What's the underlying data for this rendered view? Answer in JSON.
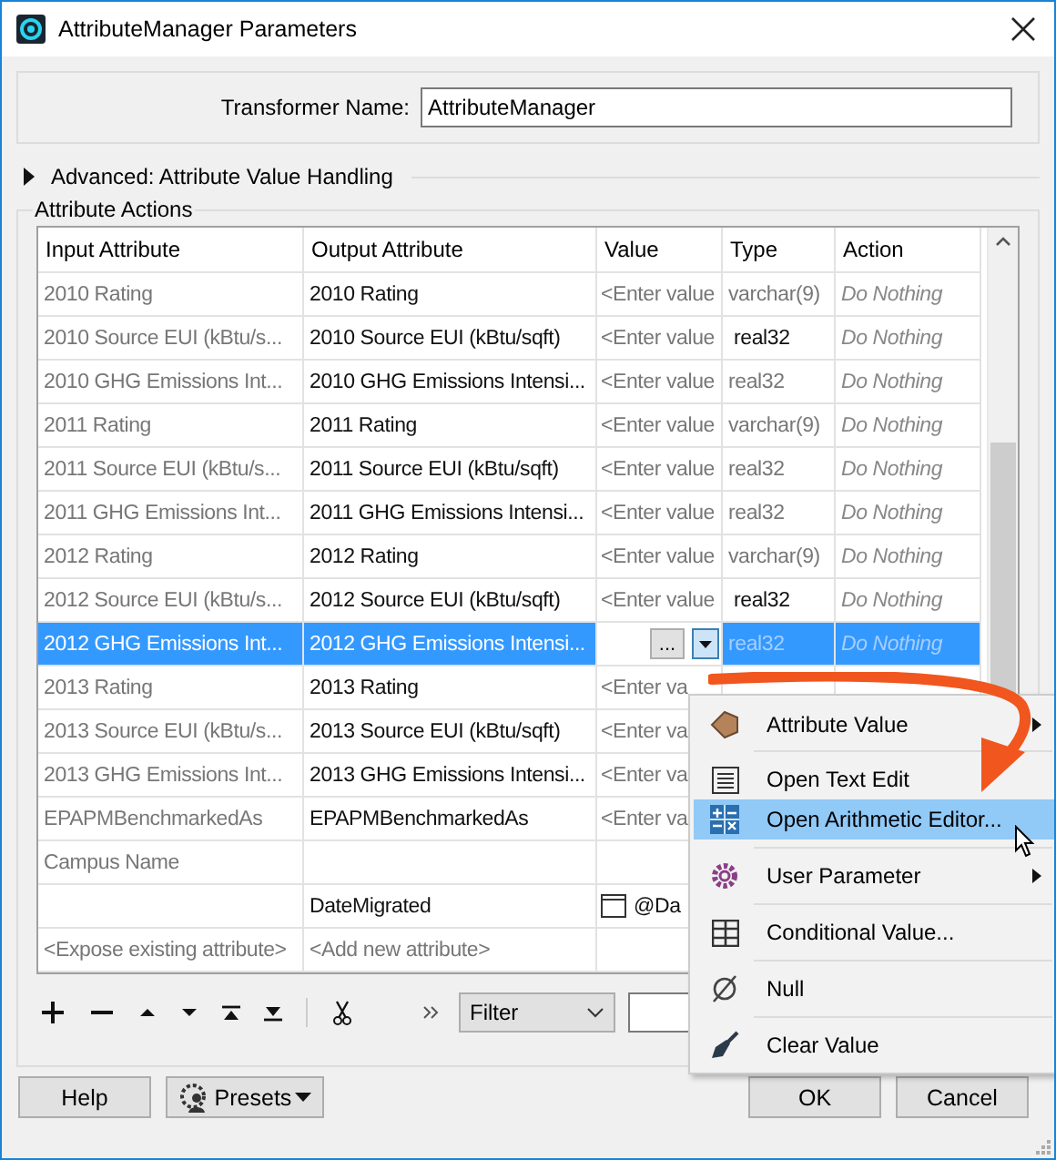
{
  "window": {
    "title": "AttributeManager Parameters"
  },
  "transformer_name": {
    "label": "Transformer Name:",
    "value": "AttributeManager"
  },
  "advanced": {
    "label": "Advanced: Attribute Value Handling",
    "expanded": false
  },
  "attribute_actions": {
    "title": "Attribute Actions",
    "columns": [
      "Input Attribute",
      "Output Attribute",
      "Value",
      "Type",
      "Action"
    ],
    "rows": [
      {
        "kind": "attribute",
        "selected": false,
        "input": "2010 Rating",
        "output": "2010 Rating",
        "value": {
          "kind": "placeholder",
          "text": "<Enter value"
        },
        "type": "varchar(9)",
        "type_changed": false,
        "action": "Do Nothing"
      },
      {
        "kind": "attribute",
        "selected": false,
        "input": "2010 Source EUI (kBtu/s...",
        "output": "2010 Source EUI (kBtu/sqft)",
        "value": {
          "kind": "placeholder",
          "text": "<Enter value"
        },
        "type": "real32",
        "type_changed": true,
        "action": "Do Nothing"
      },
      {
        "kind": "attribute",
        "selected": false,
        "input": "2010 GHG Emissions Int...",
        "output": "2010 GHG Emissions Intensi...",
        "value": {
          "kind": "placeholder",
          "text": "<Enter value"
        },
        "type": "real32",
        "type_changed": false,
        "action": "Do Nothing"
      },
      {
        "kind": "attribute",
        "selected": false,
        "input": "2011 Rating",
        "output": "2011 Rating",
        "value": {
          "kind": "placeholder",
          "text": "<Enter value"
        },
        "type": "varchar(9)",
        "type_changed": false,
        "action": "Do Nothing"
      },
      {
        "kind": "attribute",
        "selected": false,
        "input": "2011 Source EUI (kBtu/s...",
        "output": "2011 Source EUI (kBtu/sqft)",
        "value": {
          "kind": "placeholder",
          "text": "<Enter value"
        },
        "type": "real32",
        "type_changed": false,
        "action": "Do Nothing"
      },
      {
        "kind": "attribute",
        "selected": false,
        "input": "2011 GHG Emissions Int...",
        "output": "2011 GHG Emissions Intensi...",
        "value": {
          "kind": "placeholder",
          "text": "<Enter value"
        },
        "type": "real32",
        "type_changed": false,
        "action": "Do Nothing"
      },
      {
        "kind": "attribute",
        "selected": false,
        "input": "2012 Rating",
        "output": "2012 Rating",
        "value": {
          "kind": "placeholder",
          "text": "<Enter value"
        },
        "type": "varchar(9)",
        "type_changed": false,
        "action": "Do Nothing"
      },
      {
        "kind": "attribute",
        "selected": false,
        "input": "2012 Source EUI (kBtu/s...",
        "output": "2012 Source EUI (kBtu/sqft)",
        "value": {
          "kind": "placeholder",
          "text": "<Enter value"
        },
        "type": "real32",
        "type_changed": true,
        "action": "Do Nothing"
      },
      {
        "kind": "attribute",
        "selected": true,
        "input": "2012 GHG Emissions Int...",
        "output": "2012 GHG Emissions Intensi...",
        "value": {
          "kind": "editor",
          "text": "..."
        },
        "type": "real32",
        "type_changed": false,
        "action": "Do Nothing"
      },
      {
        "kind": "attribute",
        "selected": false,
        "input": "2013 Rating",
        "output": "2013 Rating",
        "value": {
          "kind": "placeholder",
          "text": "<Enter va"
        }
      },
      {
        "kind": "attribute",
        "selected": false,
        "input": "2013 Source EUI (kBtu/s...",
        "output": "2013 Source EUI (kBtu/sqft)",
        "value": {
          "kind": "placeholder",
          "text": "<Enter va"
        }
      },
      {
        "kind": "attribute",
        "selected": false,
        "input": "2013 GHG Emissions Int...",
        "output": "2013 GHG Emissions Intensi...",
        "value": {
          "kind": "placeholder",
          "text": "<Enter va"
        }
      },
      {
        "kind": "attribute",
        "selected": false,
        "input": "EPAPMBenchmarkedAs",
        "output": "EPAPMBenchmarkedAs",
        "value": {
          "kind": "placeholder",
          "text": "<Enter va"
        }
      },
      {
        "kind": "attribute",
        "selected": false,
        "input": "Campus Name"
      },
      {
        "kind": "attribute",
        "selected": false,
        "output": "DateMigrated",
        "value": {
          "kind": "attribute",
          "text": "@Da"
        }
      },
      {
        "kind": "new",
        "selected": false,
        "input": "<Expose existing attribute>",
        "output": "<Add new attribute>"
      }
    ],
    "filter": {
      "value": "Filter"
    }
  },
  "context_menu": {
    "groups": [
      [
        {
          "label": "Attribute Value",
          "submenu": true,
          "selected": false
        }
      ],
      [
        {
          "label": "Open Text Edit",
          "submenu": false,
          "selected": false
        },
        {
          "label": "Open Arithmetic Editor...",
          "submenu": false,
          "selected": true
        }
      ],
      [
        {
          "label": "User Parameter",
          "submenu": true,
          "selected": false
        }
      ],
      [
        {
          "label": "Conditional Value...",
          "submenu": false,
          "selected": false
        }
      ],
      [
        {
          "label": "Null",
          "submenu": false,
          "selected": false
        }
      ],
      [
        {
          "label": "Clear Value",
          "submenu": false,
          "selected": false
        }
      ]
    ]
  },
  "buttons": {
    "help": "Help",
    "presets": "Presets",
    "ok": "OK",
    "cancel": "Cancel"
  }
}
